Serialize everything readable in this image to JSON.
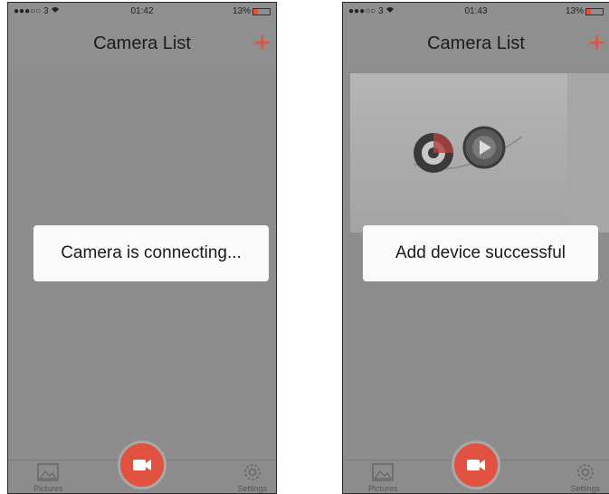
{
  "screens": [
    {
      "status": {
        "carrier": "●●●○○ 3",
        "time": "01:42",
        "battery": "13%"
      },
      "nav": {
        "title": "Camera List",
        "add_label": "+"
      },
      "toast": "Camera is connecting...",
      "tabs": {
        "pictures": "Pictures",
        "settings": "Settings"
      }
    },
    {
      "status": {
        "carrier": "●●●○○ 3",
        "time": "01:43",
        "battery": "13%"
      },
      "nav": {
        "title": "Camera List",
        "add_label": "+"
      },
      "toast": "Add device successful",
      "tabs": {
        "pictures": "Pictures",
        "settings": "Settings"
      }
    }
  ],
  "colors": {
    "accent": "#e0523f",
    "overlay": "#8f8f8f",
    "toast_bg": "#fafafa"
  },
  "icons": [
    "wifi-icon",
    "battery-icon",
    "plus-icon",
    "pictures-icon",
    "camera-icon",
    "settings-gear-icon",
    "film-reel-icon",
    "play-icon"
  ]
}
